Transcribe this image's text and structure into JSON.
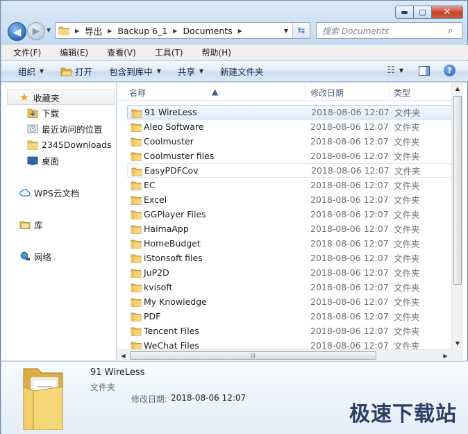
{
  "title_bar": {
    "minimize": "▬",
    "maximize": "▢",
    "close": "✕"
  },
  "address_bar": {
    "crumbs": [
      "导出",
      "Backup 6_1",
      "Documents"
    ]
  },
  "search": {
    "placeholder": "搜索 Documents"
  },
  "menu": [
    "文件(F)",
    "编辑(E)",
    "查看(V)",
    "工具(T)",
    "帮助(H)"
  ],
  "toolbar": {
    "organize": "组织",
    "open": "打开",
    "include_library": "包含到库中",
    "share": "共享",
    "new_folder": "新建文件夹"
  },
  "nav": {
    "favorites": "收藏夹",
    "favorite_items": [
      "下载",
      "最近访问的位置",
      "2345Downloads",
      "桌面"
    ],
    "wps": "WPS云文档",
    "library": "库",
    "network": "网络"
  },
  "columns": {
    "name": "名称",
    "date": "修改日期",
    "type": "类型"
  },
  "files": [
    {
      "name": "91 WireLess",
      "date": "2018-08-06 12:07",
      "type": "文件夹"
    },
    {
      "name": "Aleo Software",
      "date": "2018-08-06 12:07",
      "type": "文件夹"
    },
    {
      "name": "Coolmuster",
      "date": "2018-08-06 12:07",
      "type": "文件夹"
    },
    {
      "name": "Coolmuster files",
      "date": "2018-08-06 12:07",
      "type": "文件夹"
    },
    {
      "name": "EasyPDFCov",
      "date": "2018-08-06 12:07",
      "type": "文件夹"
    },
    {
      "name": "EC",
      "date": "2018-08-06 12:07",
      "type": "文件夹"
    },
    {
      "name": "Excel",
      "date": "2018-08-06 12:07",
      "type": "文件夹"
    },
    {
      "name": "GGPlayer Files",
      "date": "2018-08-06 12:07",
      "type": "文件夹"
    },
    {
      "name": "HaimaApp",
      "date": "2018-08-06 12:07",
      "type": "文件夹"
    },
    {
      "name": "HomeBudget",
      "date": "2018-08-06 12:07",
      "type": "文件夹"
    },
    {
      "name": "iStonsoft files",
      "date": "2018-08-06 12:07",
      "type": "文件夹"
    },
    {
      "name": "JuP2D",
      "date": "2018-08-06 12:07",
      "type": "文件夹"
    },
    {
      "name": "kvisoft",
      "date": "2018-08-06 12:07",
      "type": "文件夹"
    },
    {
      "name": "My Knowledge",
      "date": "2018-08-06 12:07",
      "type": "文件夹"
    },
    {
      "name": "PDF",
      "date": "2018-08-06 12:07",
      "type": "文件夹"
    },
    {
      "name": "Tencent Files",
      "date": "2018-08-06 12:07",
      "type": "文件夹"
    },
    {
      "name": "WeChat Files",
      "date": "2018-08-06 12:07",
      "type": "文件夹"
    }
  ],
  "details": {
    "name": "91 WireLess",
    "type": "文件夹",
    "modified_label": "修改日期:",
    "modified_value": "2018-08-06 12:07"
  },
  "watermark": "极速下载站",
  "colors": {
    "folder": "#e9c25a",
    "selection": "#dfeefc",
    "accent": "#2a6bbd"
  }
}
